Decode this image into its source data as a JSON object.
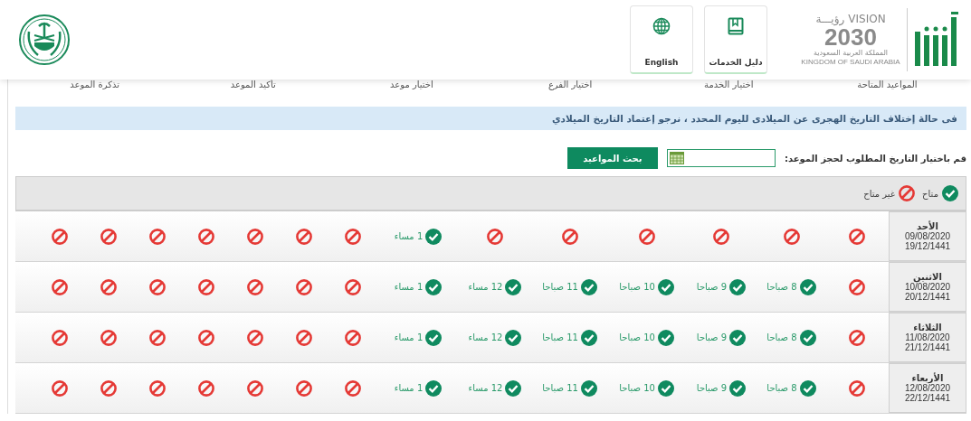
{
  "header": {
    "logo": {
      "vision": "VISION",
      "vision_ar": "رؤيـــة",
      "year": "2030",
      "country_ar": "المملكة العربية السعودية",
      "country_en": "KINGDOM OF SAUDI ARABIA"
    },
    "buttons": [
      {
        "label": "دليل الخدمات",
        "kind": "book"
      },
      {
        "label": "English",
        "kind": "globe"
      }
    ]
  },
  "steps": [
    "المواعيد المتاحة",
    "اختيار الخدمة",
    "اختيار الفرع",
    "اختيار موعد",
    "تأكيد الموعد",
    "تذكرة الموعد"
  ],
  "notice": "فى حالة إختلاف التاريخ الهجرى عن الميلادى لليوم المحدد ، نرجو إعتماد التاريخ الميلادي",
  "date_picker": {
    "label": "قم باختيار التاريخ المطلوب لحجز الموعد:",
    "search_button": "بحث المواعيد"
  },
  "legend": [
    {
      "available": true,
      "label": "متاح"
    },
    {
      "available": false,
      "label": "غير متاح"
    }
  ],
  "days": [
    {
      "day": "الأحد",
      "gregorian": "09/08/2020",
      "hijri": "19/12/1441",
      "slots": [
        {
          "available": false
        },
        {
          "available": false
        },
        {
          "available": false
        },
        {
          "available": false
        },
        {
          "available": false
        },
        {
          "available": false
        },
        {
          "available": true,
          "label": "1 مساء"
        },
        {
          "available": false
        },
        {
          "available": false
        },
        {
          "available": false
        },
        {
          "available": false
        },
        {
          "available": false
        },
        {
          "available": false
        },
        {
          "available": false
        }
      ]
    },
    {
      "day": "الاثنين",
      "gregorian": "10/08/2020",
      "hijri": "20/12/1441",
      "slots": [
        {
          "available": false
        },
        {
          "available": true,
          "label": "8 صباحا"
        },
        {
          "available": true,
          "label": "9 صباحا"
        },
        {
          "available": true,
          "label": "10 صباحا"
        },
        {
          "available": true,
          "label": "11 صباحا"
        },
        {
          "available": true,
          "label": "12 مساء"
        },
        {
          "available": true,
          "label": "1 مساء"
        },
        {
          "available": false
        },
        {
          "available": false
        },
        {
          "available": false
        },
        {
          "available": false
        },
        {
          "available": false
        },
        {
          "available": false
        },
        {
          "available": false
        }
      ]
    },
    {
      "day": "الثلاثاء",
      "gregorian": "11/08/2020",
      "hijri": "21/12/1441",
      "slots": [
        {
          "available": false
        },
        {
          "available": true,
          "label": "8 صباحا"
        },
        {
          "available": true,
          "label": "9 صباحا"
        },
        {
          "available": true,
          "label": "10 صباحا"
        },
        {
          "available": true,
          "label": "11 صباحا"
        },
        {
          "available": true,
          "label": "12 مساء"
        },
        {
          "available": true,
          "label": "1 مساء"
        },
        {
          "available": false
        },
        {
          "available": false
        },
        {
          "available": false
        },
        {
          "available": false
        },
        {
          "available": false
        },
        {
          "available": false
        },
        {
          "available": false
        }
      ]
    },
    {
      "day": "الأربعاء",
      "gregorian": "12/08/2020",
      "hijri": "22/12/1441",
      "slots": [
        {
          "available": false
        },
        {
          "available": true,
          "label": "8 صباحا"
        },
        {
          "available": true,
          "label": "9 صباحا"
        },
        {
          "available": true,
          "label": "10 صباحا"
        },
        {
          "available": true,
          "label": "11 صباحا"
        },
        {
          "available": true,
          "label": "12 مساء"
        },
        {
          "available": true,
          "label": "1 مساء"
        },
        {
          "available": false
        },
        {
          "available": false
        },
        {
          "available": false
        },
        {
          "available": false
        },
        {
          "available": false
        },
        {
          "available": false
        },
        {
          "available": false
        }
      ]
    }
  ]
}
